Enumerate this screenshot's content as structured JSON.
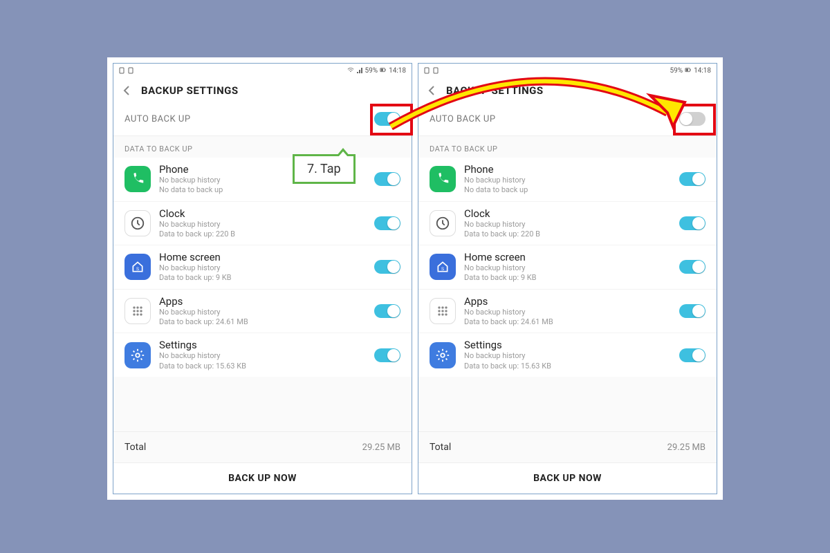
{
  "statusbar": {
    "battery": "59%",
    "time": "14:18"
  },
  "header": {
    "title": "BACKUP SETTINGS"
  },
  "auto_backup": {
    "label": "AUTO BACK UP"
  },
  "section_heading": "DATA TO BACK UP",
  "items": [
    {
      "title": "Phone",
      "sub1": "No backup history",
      "sub2": "No data to back up",
      "icon": "phone-icon",
      "icon_class": "ic-phone",
      "toggle": true
    },
    {
      "title": "Clock",
      "sub1": "No backup history",
      "sub2": "Data to back up: 220 B",
      "icon": "clock-icon",
      "icon_class": "ic-clock",
      "toggle": true
    },
    {
      "title": "Home screen",
      "sub1": "No backup history",
      "sub2": "Data to back up: 9 KB",
      "icon": "home-icon",
      "icon_class": "ic-home",
      "toggle": true
    },
    {
      "title": "Apps",
      "sub1": "No backup history",
      "sub2": "Data to back up: 24.61 MB",
      "icon": "apps-icon",
      "icon_class": "ic-apps",
      "toggle": true
    },
    {
      "title": "Settings",
      "sub1": "No backup history",
      "sub2": "Data to back up: 15.63 KB",
      "icon": "settings-icon",
      "icon_class": "ic-settings",
      "toggle": true
    }
  ],
  "total": {
    "label": "Total",
    "value": "29.25 MB"
  },
  "backup_button": "BACK UP NOW",
  "screens": [
    {
      "auto_toggle_on": true
    },
    {
      "auto_toggle_on": false
    }
  ],
  "annotation": {
    "callout_text": "7. Tap"
  }
}
